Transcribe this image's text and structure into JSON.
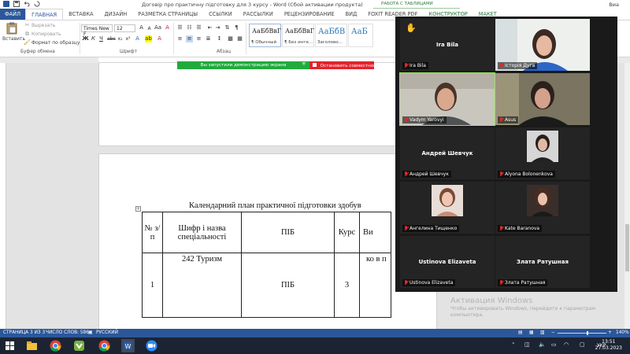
{
  "window": {
    "title": "Договір про практичну підготовку  для 3 курсу - Word (Сбой активации продукта)",
    "context_group": "РАБОТА С ТАБЛИЦАМИ",
    "user": "Виа"
  },
  "tabs": [
    {
      "label": "ФАЙЛ"
    },
    {
      "label": "ГЛАВНАЯ"
    },
    {
      "label": "ВСТАВКА"
    },
    {
      "label": "ДИЗАЙН"
    },
    {
      "label": "РАЗМЕТКА СТРАНИЦЫ"
    },
    {
      "label": "ССЫЛКИ"
    },
    {
      "label": "РАССЫЛКИ"
    },
    {
      "label": "РЕЦЕНЗИРОВАНИЕ"
    },
    {
      "label": "ВИД"
    },
    {
      "label": "FOXIT READER PDF"
    },
    {
      "label": "КОНСТРУКТОР"
    },
    {
      "label": "МАКЕТ"
    }
  ],
  "ribbon": {
    "paste": "Вставить",
    "cut": "Вырезать",
    "copy": "Копировать",
    "format_painter": "Формат по образцу",
    "clipboard_group": "Буфер обмена",
    "font_name": "Times New F",
    "font_size": "12",
    "font_group": "Шрифт",
    "paragraph_group": "Абзац",
    "styles": [
      {
        "sample": "АаБбВвГ",
        "name": "¶ Обычный"
      },
      {
        "sample": "АаБбВвГ",
        "name": "¶ Без инте..."
      },
      {
        "sample": "АаБбВ",
        "name": "Заголово..."
      },
      {
        "sample": "АаБ",
        "name": ""
      }
    ]
  },
  "share_banner": {
    "status": "Вы запустили демонстрацию экрана",
    "stop": "Остановить совместное и"
  },
  "document": {
    "heading": "Календарний план практичної підготовки здобув",
    "table": {
      "headers": [
        "№ з/п",
        "Шифр і назва спеціальності",
        "ПІБ",
        "Курс",
        "Ви"
      ],
      "row": [
        "1",
        "242 Туризм",
        "ПІБ",
        "3",
        "ко в п"
      ]
    }
  },
  "zoom": {
    "participants": [
      {
        "name": "Ira Bila",
        "label": "Ira Bila",
        "type": "name-only",
        "hand": true
      },
      {
        "name": "",
        "label": "Історія Дуга",
        "type": "photo"
      },
      {
        "name": "",
        "label": "Vadym Yarovyi",
        "type": "photo",
        "speaking": true
      },
      {
        "name": "",
        "label": "Asus",
        "type": "photo"
      },
      {
        "name": "Андрей Шевчук",
        "label": "Андрей Шевчук",
        "type": "name-only"
      },
      {
        "name": "",
        "label": "Alyona Bolonenkova",
        "type": "thumb"
      },
      {
        "name": "",
        "label": "Ангелина Тищенко",
        "type": "thumb"
      },
      {
        "name": "",
        "label": "Kate Baranova",
        "type": "thumb"
      },
      {
        "name": "Ustinova Elizaveta",
        "label": "Ustinova Elizaveta",
        "type": "name-only"
      },
      {
        "name": "Злата Ратушная",
        "label": "Злата Ратушная",
        "type": "name-only"
      }
    ]
  },
  "watermark": {
    "title": "Активация Windows",
    "text": "Чтобы активировать Windows, перейдите к параметрам компьютера."
  },
  "statusbar": {
    "page": "СТРАНИЦА 3 ИЗ 3",
    "words": "ЧИСЛО СЛОВ: 586",
    "lang": "РУССКИЙ",
    "zoom": "140%"
  },
  "taskbar": {
    "lang": "УКР",
    "time": "13:51",
    "date": "27.03.2023"
  },
  "colors": {
    "word_blue": "#2b579a",
    "share_green": "#21ab3c",
    "share_red": "#e3232f",
    "table_context_green": "#2b7a3c"
  }
}
